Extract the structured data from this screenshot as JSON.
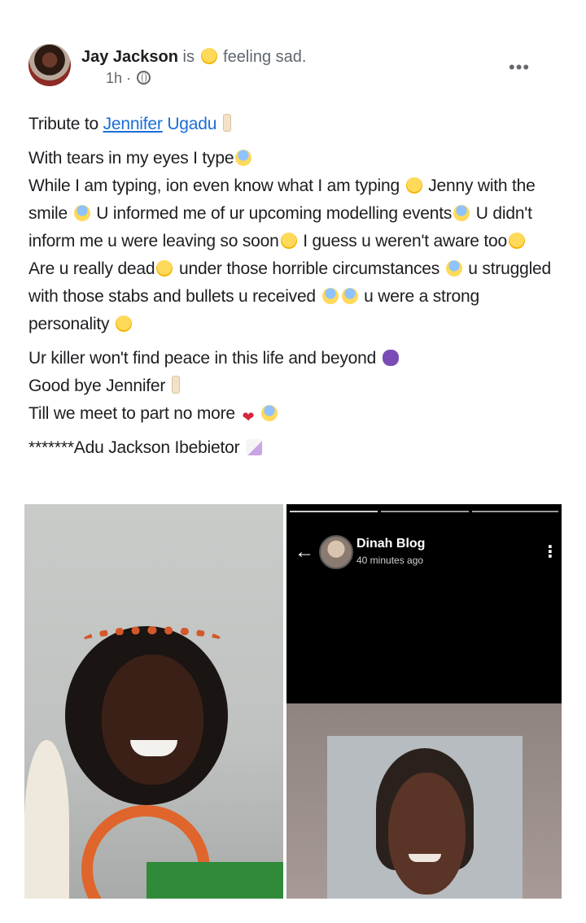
{
  "post": {
    "author": "Jay Jackson",
    "is_text": "is",
    "feeling": "feeling sad.",
    "time": "1h ·",
    "more_label": "•••",
    "tribute": {
      "prefix": "Tribute to ",
      "link_first": "Jennifer",
      "link_last": "Ugadu"
    },
    "body": {
      "l1": "With tears in my eyes I type",
      "l2a": "While I am typing, ion even know what I am typing ",
      "l2b": " Jenny with the smile ",
      "l2c": " U informed me of ur upcoming modelling events",
      "l2d": " U didn't inform me u were leaving so soon",
      "l2e": " I guess u weren't aware too",
      "l3a": "Are u really dead",
      "l3b": " under those horrible circumstances ",
      "l3c": " u struggled with those stabs and bullets u received ",
      "l3d": " u were a strong personality "
    },
    "closing": {
      "c1": "Ur killer won't find peace in this life and beyond ",
      "c2": "Good bye Jennifer ",
      "c3": "Till we meet to part no more "
    },
    "signature": "*******Adu Jackson Ibebietor "
  },
  "story": {
    "name": "Dinah Blog",
    "time": "40 minutes ago",
    "back_icon": "←",
    "menu_icon": "⋮"
  }
}
